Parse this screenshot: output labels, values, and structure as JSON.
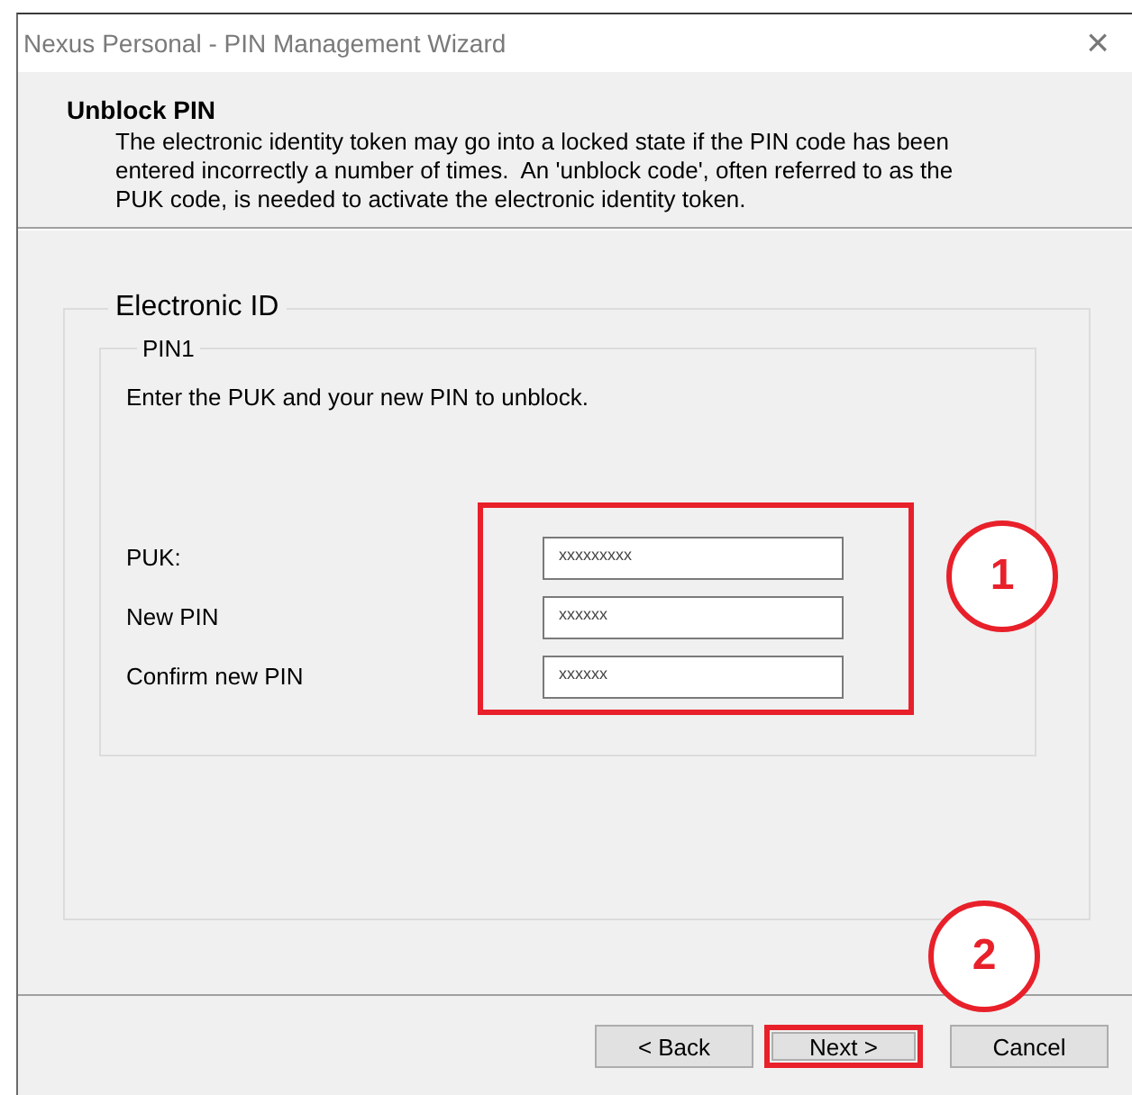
{
  "window": {
    "title": "Nexus Personal - PIN Management Wizard",
    "close": "×"
  },
  "header": {
    "title": "Unblock PIN",
    "description": "The electronic identity token may go into a locked state if the PIN code has been entered incorrectly a number of times.  An 'unblock code', often referred to as the PUK code, is needed to activate the electronic identity token."
  },
  "group": {
    "title": "Electronic ID",
    "inner_group": {
      "title": "PIN1",
      "instruction": "Enter the PUK and your new PIN to unblock.",
      "highlighted": true,
      "fields": [
        {
          "label": "PUK:",
          "value": "xxxxxxxxx"
        },
        {
          "label": "New PIN",
          "value": "xxxxxx"
        },
        {
          "label": "Confirm new PIN",
          "value": "xxxxxx"
        }
      ]
    }
  },
  "buttons": [
    {
      "label": "< Back",
      "highlighted": false
    },
    {
      "label": "Next >",
      "highlighted": true
    },
    {
      "label": "Cancel",
      "highlighted": false
    }
  ],
  "callouts": [
    {
      "label": "1"
    },
    {
      "label": "2"
    }
  ]
}
